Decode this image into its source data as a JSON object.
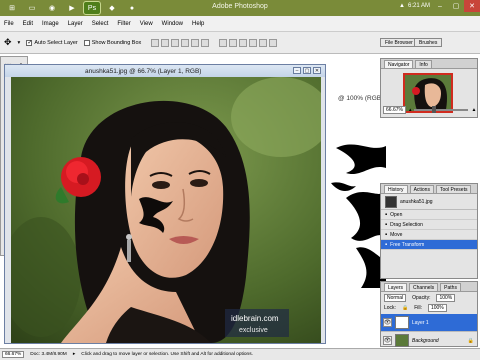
{
  "window": {
    "title": "Adobe Photoshop",
    "clock": "6:21 AM"
  },
  "menu": [
    "File",
    "Edit",
    "Image",
    "Layer",
    "Select",
    "Filter",
    "View",
    "Window",
    "Help"
  ],
  "options": {
    "auto_select_label": "Auto Select Layer",
    "auto_select_checked": true,
    "show_bbox_label": "Show Bounding Box",
    "show_bbox_checked": false
  },
  "palette_well": [
    "File Browser",
    "Brushes"
  ],
  "document": {
    "title": "anushka51.jpg @ 66.7% (Layer 1, RGB)",
    "watermark_line1": "idlebrain.com",
    "watermark_line2": "exclusive"
  },
  "background_document": {
    "title": "@ 100% (RGB)"
  },
  "navigator": {
    "tabs": [
      "Navigator",
      "Info"
    ],
    "zoom": "66.67%"
  },
  "history": {
    "tabs": [
      "History",
      "Actions",
      "Tool Presets"
    ],
    "snapshot": "anushka51.jpg",
    "states": [
      {
        "label": "Open",
        "selected": false
      },
      {
        "label": "Drag Selection",
        "selected": false
      },
      {
        "label": "Move",
        "selected": false
      },
      {
        "label": "Free Transform",
        "selected": true
      }
    ]
  },
  "layers": {
    "tabs": [
      "Layers",
      "Channels",
      "Paths"
    ],
    "blend_mode": "Normal",
    "opacity_label": "Opacity:",
    "opacity": "100%",
    "lock_label": "Lock:",
    "fill_label": "Fill:",
    "fill": "100%",
    "items": [
      {
        "name": "Layer 1",
        "selected": true
      },
      {
        "name": "Background",
        "selected": false
      }
    ]
  },
  "status": {
    "zoom": "66.67%",
    "doc": "Doc: 3.4M/8.90M",
    "hint": "Click and drag to move layer or selection. Use Shift and Alt for additional options."
  },
  "colors": {
    "taskbar": "#7a8b39",
    "foreground": "#e0201c",
    "background": "#ffffff",
    "selection": "#2e6bd6"
  }
}
